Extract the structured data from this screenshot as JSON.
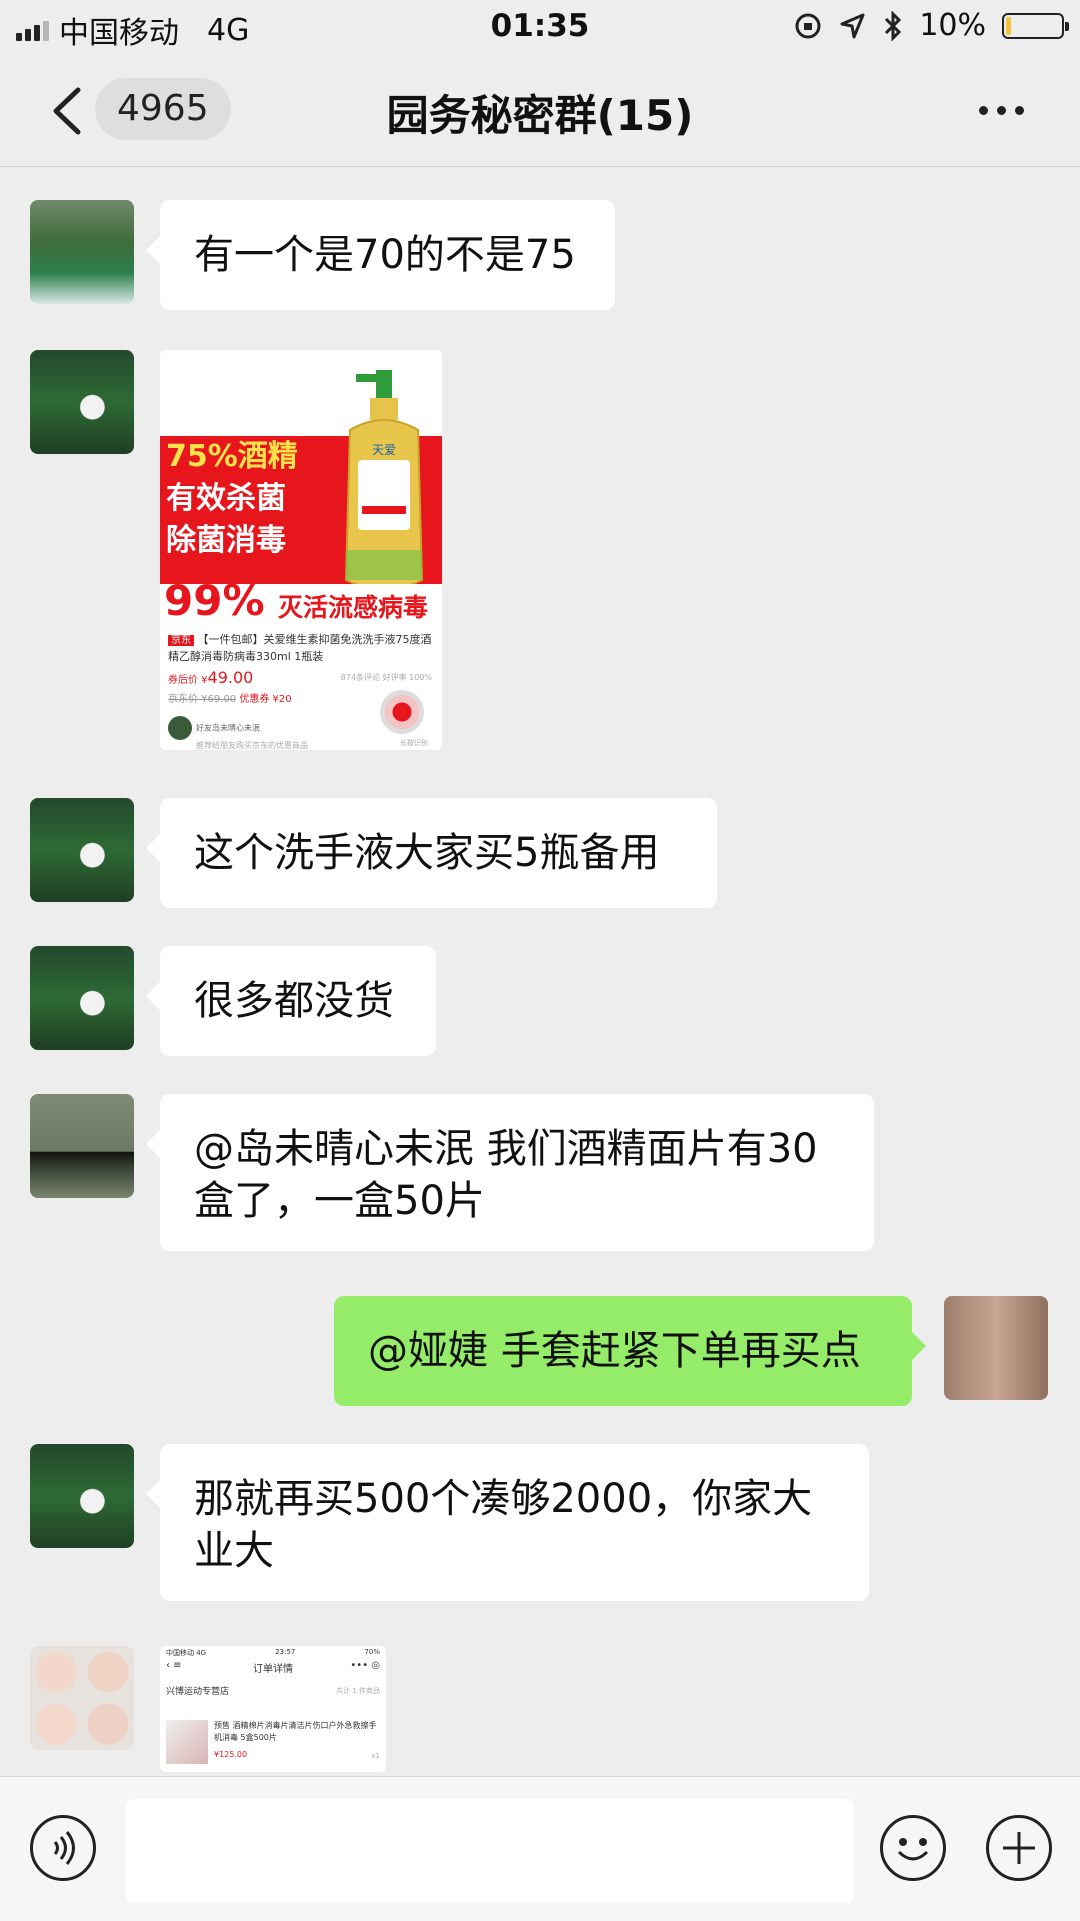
{
  "status_bar": {
    "carrier": "中国移动",
    "network": "4G",
    "time": "01:35",
    "battery": "10%",
    "battery_level": 0.1
  },
  "nav": {
    "back_count": "4965",
    "title": "园务秘密群(15)"
  },
  "messages": [
    {
      "side": "left",
      "type": "text",
      "text": "有一个是70的不是75"
    },
    {
      "side": "left",
      "type": "image",
      "card": {
        "headline_1": "75%酒精",
        "headline_2": "有效杀菌",
        "headline_3": "除菌消毒",
        "big_pct": "99%",
        "big_txt": "灭活流感病毒",
        "bottle_brand": "天爱",
        "jd_tag": "京东",
        "desc": "【一件包邮】关爱维生素抑菌免洗洗手液75度酒精乙醇消毒防病毒330ml 1瓶装",
        "price_label": "券后价 ¥",
        "price": "49.00",
        "old_price": "京东价 ¥69.00",
        "coupon": "优惠券 ¥20",
        "meta": "874条评论  好评率 100%",
        "share": "好友岛未晴心未泯",
        "share_sub": "推荐给朋友购买京东的优惠商品",
        "qr_label": "长按识别"
      }
    },
    {
      "side": "left",
      "type": "text",
      "text": "这个洗手液大家买5瓶备用"
    },
    {
      "side": "left",
      "type": "text",
      "text": "很多都没货"
    },
    {
      "side": "left",
      "type": "text",
      "text": "@岛未晴心未泯 我们酒精面片有30盒了，一盒50片"
    },
    {
      "side": "right",
      "type": "text",
      "text": "@娅婕 手套赶紧下单再买点"
    },
    {
      "side": "left",
      "type": "text",
      "text": "那就再买500个凑够2000，你家大业大"
    },
    {
      "side": "left",
      "type": "image",
      "order": {
        "status_left": "中国移动 4G",
        "status_time": "23:57",
        "status_right": "70%",
        "title": "订单详情",
        "shop": "兴博运动专营店",
        "count": "共计 1 件商品",
        "item": "预售 酒精棉片消毒片清洁片伤口户外急救擦手机消毒 5盒500片",
        "price": "¥125.00",
        "qty": "x1"
      }
    }
  ],
  "input": {
    "placeholder": ""
  }
}
